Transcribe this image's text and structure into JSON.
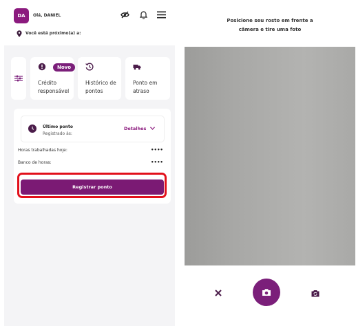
{
  "header": {
    "avatar_initials": "DA",
    "greeting": "Olá, DANIEL",
    "nearby": "Você está próximo(a) a:"
  },
  "shortcuts": [
    {
      "icon": "alert-circle-icon",
      "badge": "Novo",
      "label_line1": "Crédito",
      "label_line2": "responsável"
    },
    {
      "icon": "history-icon",
      "label_line1": "Histórico de",
      "label_line2": "pontos"
    },
    {
      "icon": "truck-icon",
      "label_line1": "Ponto em",
      "label_line2": "atraso"
    }
  ],
  "last_punch": {
    "title": "Último ponto",
    "subtitle": "Registrado às:",
    "details": "Detalhes"
  },
  "rows": {
    "hours_worked_label": "Horas trabalhadas hoje:",
    "hours_worked_value": "••••",
    "bank_label": "Banco de horas:",
    "bank_value": "••••"
  },
  "register_button": "Registrar ponto",
  "camera": {
    "instruction_line1": "Posicione seu rosto em frente a",
    "instruction_line2": "câmera e tire uma foto"
  },
  "colors": {
    "brand": "#7b1f7a",
    "highlight": "#e2101b",
    "camera_bg": "#a8a8a6"
  }
}
